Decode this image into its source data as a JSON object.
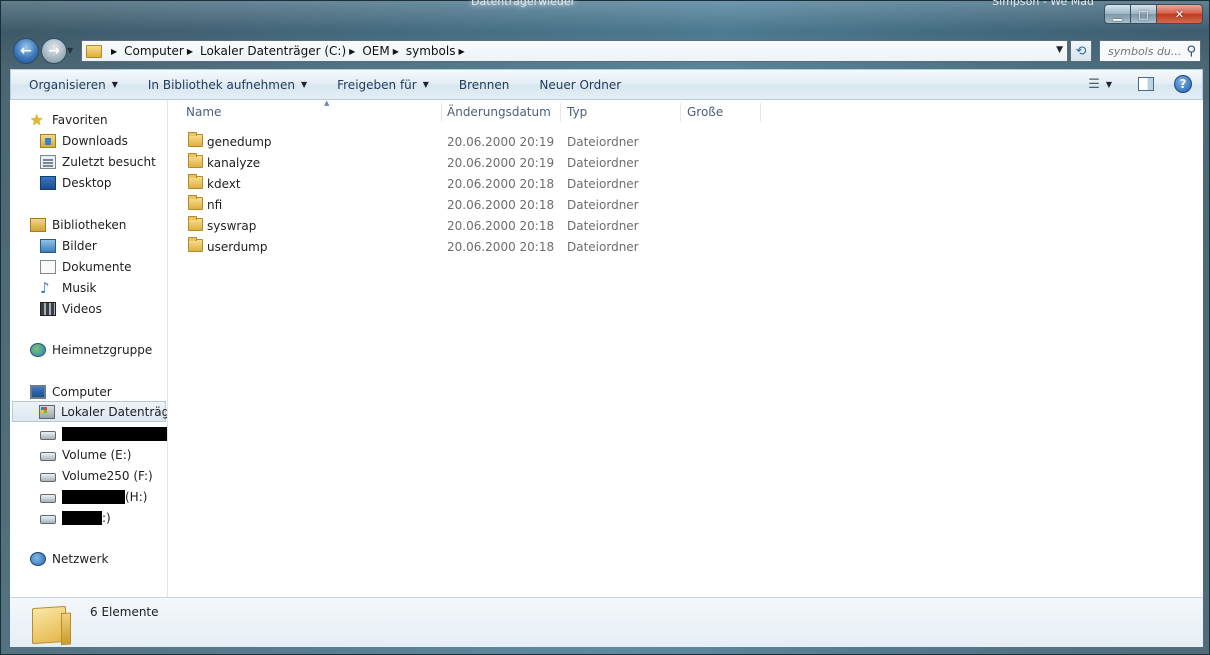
{
  "window": {
    "title_partial": "Datenträgerwieder",
    "title_right_partial": "Simpson - We Mad"
  },
  "address": {
    "breadcrumbs": [
      "Computer",
      "Lokaler Datenträger (C:)",
      "OEM",
      "symbols"
    ]
  },
  "search": {
    "placeholder": "symbols du..."
  },
  "toolbar": {
    "organize": "Organisieren",
    "include_library": "In Bibliothek aufnehmen",
    "share": "Freigeben für",
    "burn": "Brennen",
    "new_folder": "Neuer Ordner",
    "help": "?"
  },
  "nav": {
    "favorites": "Favoriten",
    "downloads": "Downloads",
    "recent": "Zuletzt besucht",
    "desktop": "Desktop",
    "libraries": "Bibliotheken",
    "pictures": "Bilder",
    "documents": "Dokumente",
    "music": "Musik",
    "videos": "Videos",
    "homegroup": "Heimnetzgruppe",
    "computer": "Computer",
    "local_disk": "Lokaler Datenträger",
    "volume_e": "Volume (E:)",
    "volume_f": "Volume250 (F:)",
    "drive_h_suffix": "(H:)",
    "drive_last_suffix": ":)",
    "network": "Netzwerk"
  },
  "columns": {
    "name": "Name",
    "modified": "Änderungsdatum",
    "type": "Typ",
    "size": "Große"
  },
  "files": [
    {
      "name": "genedump",
      "date": "20.06.2000 20:19",
      "type": "Dateiordner"
    },
    {
      "name": "kanalyze",
      "date": "20.06.2000 20:19",
      "type": "Dateiordner"
    },
    {
      "name": "kdext",
      "date": "20.06.2000 20:18",
      "type": "Dateiordner"
    },
    {
      "name": "nfi",
      "date": "20.06.2000 20:18",
      "type": "Dateiordner"
    },
    {
      "name": "syswrap",
      "date": "20.06.2000 20:18",
      "type": "Dateiordner"
    },
    {
      "name": "userdump",
      "date": "20.06.2000 20:18",
      "type": "Dateiordner"
    }
  ],
  "status": {
    "count": "6 Elemente"
  }
}
